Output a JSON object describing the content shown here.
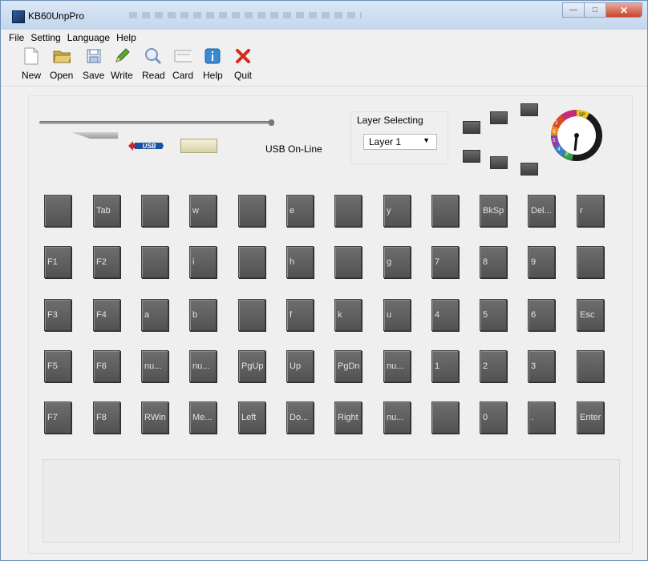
{
  "window": {
    "title": "KB60UnpPro"
  },
  "menu": [
    "File",
    "Setting",
    "Language",
    "Help"
  ],
  "toolbar": [
    {
      "label": "New",
      "icon": "new-file-icon"
    },
    {
      "label": "Open",
      "icon": "open-folder-icon"
    },
    {
      "label": "Save",
      "icon": "save-icon"
    },
    {
      "label": "Write",
      "icon": "pencil-icon"
    },
    {
      "label": "Read",
      "icon": "magnifier-icon"
    },
    {
      "label": "Card",
      "icon": "card-icon"
    },
    {
      "label": "Help",
      "icon": "info-icon"
    },
    {
      "label": "Quit",
      "icon": "red-x-icon"
    }
  ],
  "usb": {
    "logo_text": "USB",
    "status": "USB On-Line"
  },
  "layer": {
    "caption": "Layer Selecting",
    "selected": "Layer 1"
  },
  "dial": {
    "labels": [
      "SP",
      "2",
      "6",
      "5",
      "4",
      "P"
    ]
  },
  "keys": [
    [
      "",
      "Tab",
      "",
      "w",
      "",
      "e",
      "",
      "y",
      "",
      "BkSp",
      "Del...",
      "r"
    ],
    [
      "F1",
      "F2",
      "",
      "i",
      "",
      "h",
      "",
      "g",
      "7",
      "8",
      "9",
      ""
    ],
    [
      "F3",
      "F4",
      "a",
      "b",
      "",
      "f",
      "k",
      "u",
      "4",
      "5",
      "6",
      "Esc"
    ],
    [
      "F5",
      "F6",
      "nu...",
      "nu...",
      "PgUp",
      "Up",
      "PgDn",
      "nu...",
      "1",
      "2",
      "3",
      ""
    ],
    [
      "F7",
      "F8",
      "RWin",
      "Me...",
      "Left",
      "Do...",
      "Right",
      "nu...",
      "",
      "0",
      ".",
      "Enter"
    ]
  ],
  "colors": {
    "key": "#5e5e5e",
    "title_gradient": "#c3d6ec",
    "close": "#c8452b"
  }
}
